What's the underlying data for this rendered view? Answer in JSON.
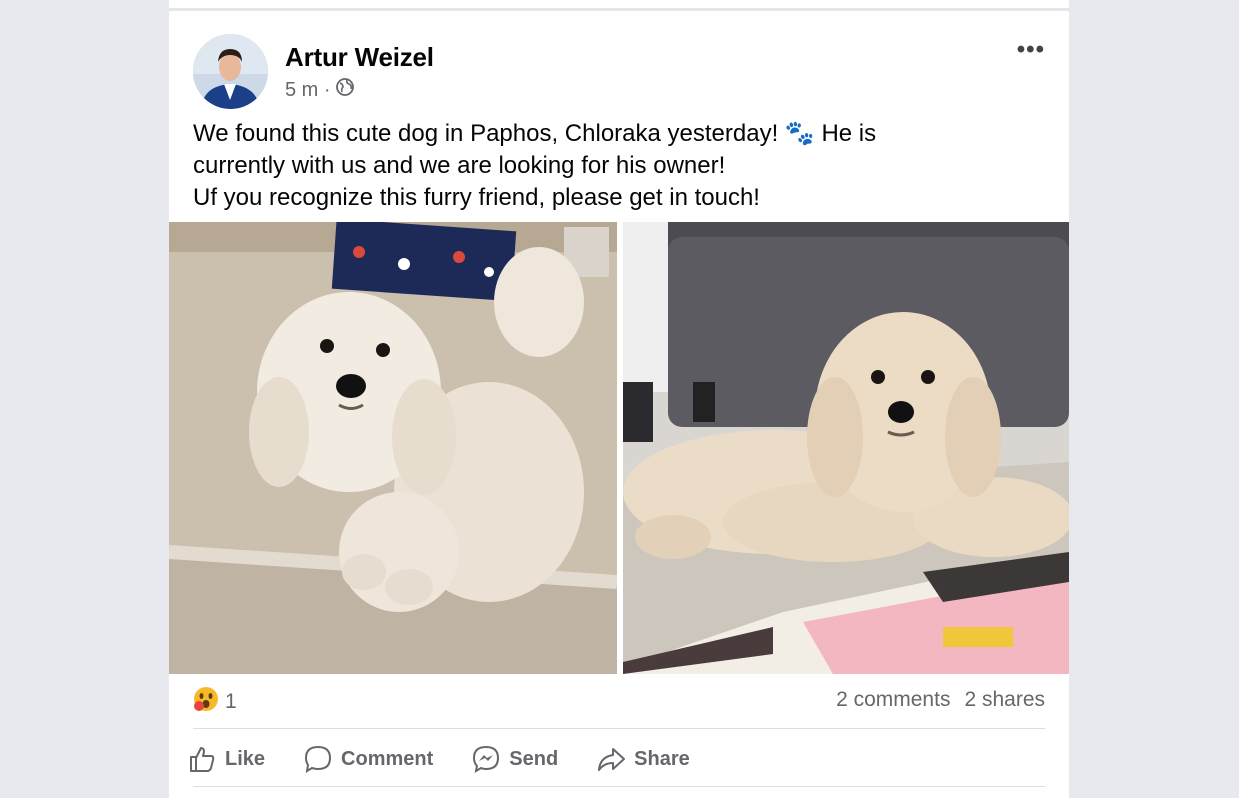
{
  "post": {
    "author": "Artur Weizel",
    "time": "5 m ·",
    "privacy_icon": "globe-icon",
    "more_label": "•••",
    "text_lines": [
      "We found this cute dog in Paphos, Chloraka yesterday! 🐾 He is",
      "currently with us and we are looking for his owner!",
      "Uf you recognize this furry friend, please get in touch!"
    ],
    "photos": [
      {
        "name": "dog-photo-left",
        "desc_icon": "dog-sitting-image"
      },
      {
        "name": "dog-photo-right",
        "desc_icon": "dog-lying-image"
      }
    ],
    "reaction_icon": "wow-reaction-icon",
    "reaction_count": "1",
    "comments": "2 comments",
    "shares": "2 shares"
  },
  "actions": {
    "like": "Like",
    "comment": "Comment",
    "send": "Send",
    "share": "Share"
  },
  "colors": {
    "background": "#e8e9ee",
    "card": "#ffffff",
    "text": "#050505",
    "secondary": "#65676b"
  }
}
